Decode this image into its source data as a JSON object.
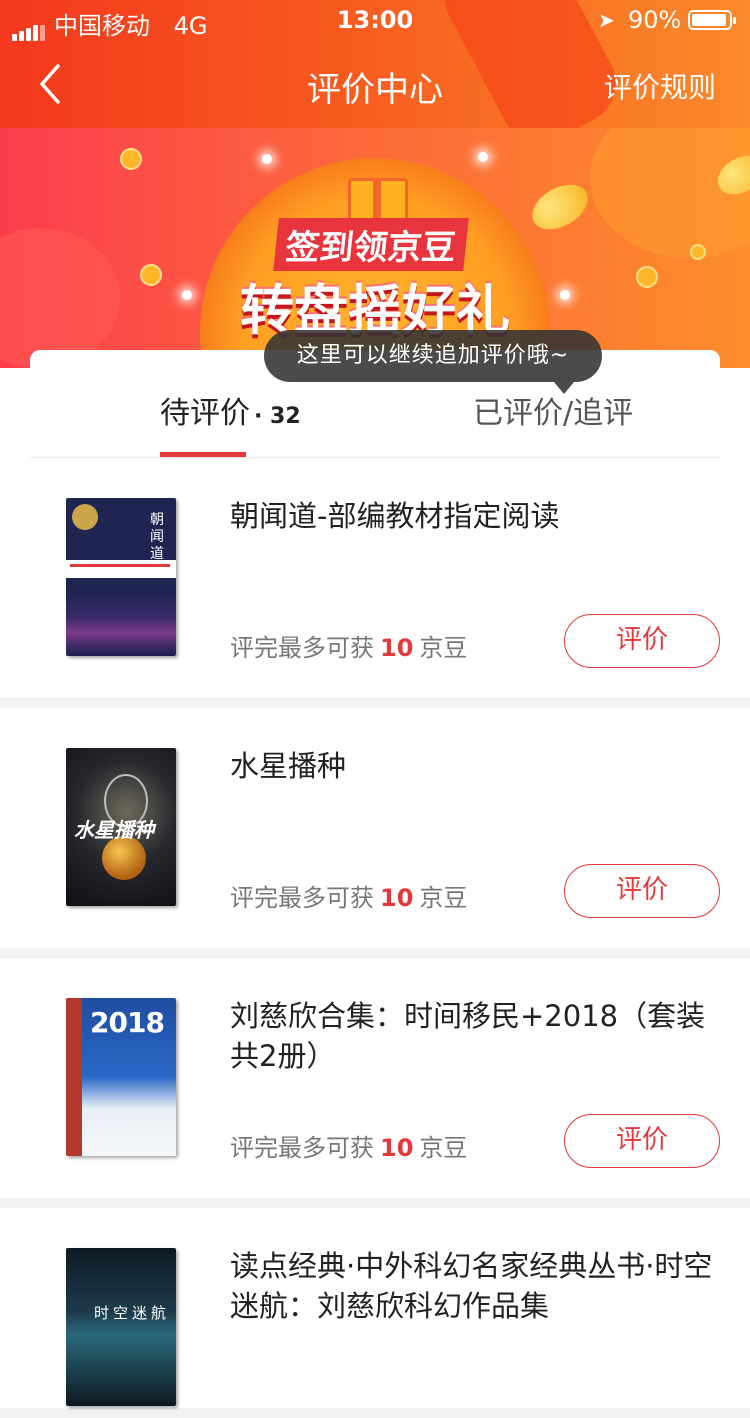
{
  "status_bar": {
    "carrier": "中国移动",
    "network": "4G",
    "time": "13:00",
    "battery": "90%"
  },
  "nav": {
    "title": "评价中心",
    "right_label": "评价规则"
  },
  "banner": {
    "line1": "签到领京豆",
    "line2": "转盘摇好礼"
  },
  "tooltip": "这里可以继续追加评价哦~",
  "tabs": {
    "pending_label": "待评价",
    "pending_count": "· 32",
    "done_label": "已评价/追评"
  },
  "items": [
    {
      "title": "朝闻道-部编教材指定阅读",
      "reward_prefix": "评完最多可获",
      "reward_amount": "10",
      "reward_unit": "京豆",
      "button": "评价",
      "cover_text": "朝闻道"
    },
    {
      "title": "水星播种",
      "reward_prefix": "评完最多可获",
      "reward_amount": "10",
      "reward_unit": "京豆",
      "button": "评价",
      "cover_text": "水星播种"
    },
    {
      "title": "刘慈欣合集：时间移民+2018（套装共2册）",
      "reward_prefix": "评完最多可获",
      "reward_amount": "10",
      "reward_unit": "京豆",
      "button": "评价",
      "cover_text": "2018"
    },
    {
      "title": "读点经典·中外科幻名家经典丛书·时空迷航：刘慈欣科幻作品集",
      "cover_text": "时空迷航"
    }
  ]
}
